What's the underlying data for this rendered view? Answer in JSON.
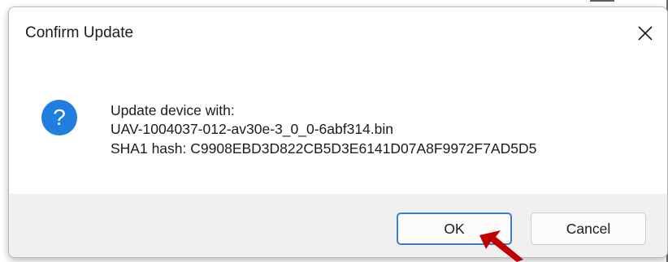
{
  "dialog": {
    "title": "Confirm Update",
    "icon": "question-icon",
    "icon_glyph": "?",
    "message_lines": [
      "Update device with:",
      "UAV-1004037-012-av30e-3_0_0-6abf314.bin",
      "SHA1 hash: C9908EBD3D822CB5D3E6141D07A8F9972F7AD5D5"
    ],
    "buttons": {
      "ok_label": "OK",
      "cancel_label": "Cancel"
    }
  },
  "colors": {
    "accent": "#1f7ee0",
    "focus_border": "#3d7ec9",
    "footer_bg": "#f0f0f0",
    "annotation_arrow": "#c00000"
  }
}
